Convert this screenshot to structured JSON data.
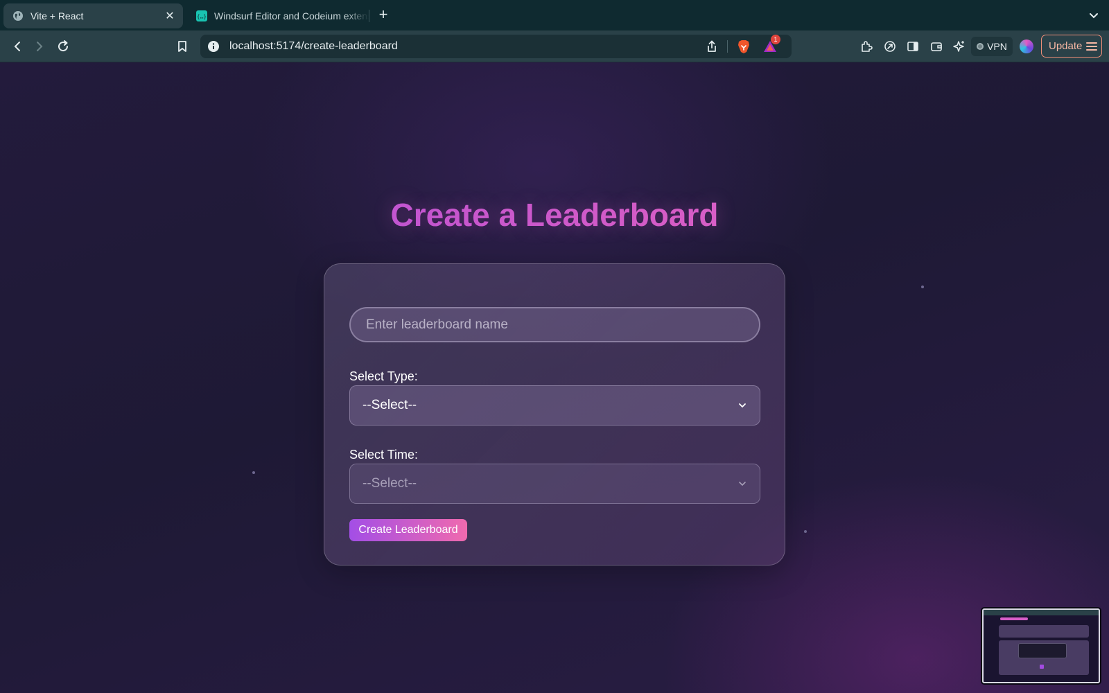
{
  "browser": {
    "tabs": [
      {
        "title": "Vite + React",
        "active": true
      },
      {
        "title": "Windsurf Editor and Codeium extensions",
        "active": false
      }
    ],
    "close_symbol": "✕",
    "new_tab_symbol": "+",
    "url": "localhost:5174/create-leaderboard",
    "rewards_badge": "1",
    "vpn_label": "VPN",
    "update_label": "Update",
    "icons": [
      "globe-icon",
      "windsurf-icon",
      "back-icon",
      "forward-icon",
      "reload-icon",
      "bookmark-icon",
      "info-icon",
      "share-icon",
      "brave-lion-icon",
      "brave-rewards-icon",
      "extensions-icon",
      "leo-icon",
      "sidebar-icon",
      "wallet-icon",
      "ai-star-icon",
      "vpn-icon",
      "hamburger-icon"
    ]
  },
  "page": {
    "title": "Create a Leaderboard",
    "form": {
      "name_placeholder": "Enter leaderboard name",
      "name_value": "",
      "type_label": "Select Type:",
      "type_selected": "--Select--",
      "time_label": "Select Time:",
      "time_selected": "--Select--",
      "submit_label": "Create Leaderboard"
    }
  },
  "colors": {
    "title_gradient_start": "#a24be0",
    "title_gradient_end": "#e76fc6",
    "button_gradient_start": "#a34ee6",
    "button_gradient_end": "#f06aae",
    "page_background": "#211a3a",
    "browser_chrome": "#2a4148"
  }
}
